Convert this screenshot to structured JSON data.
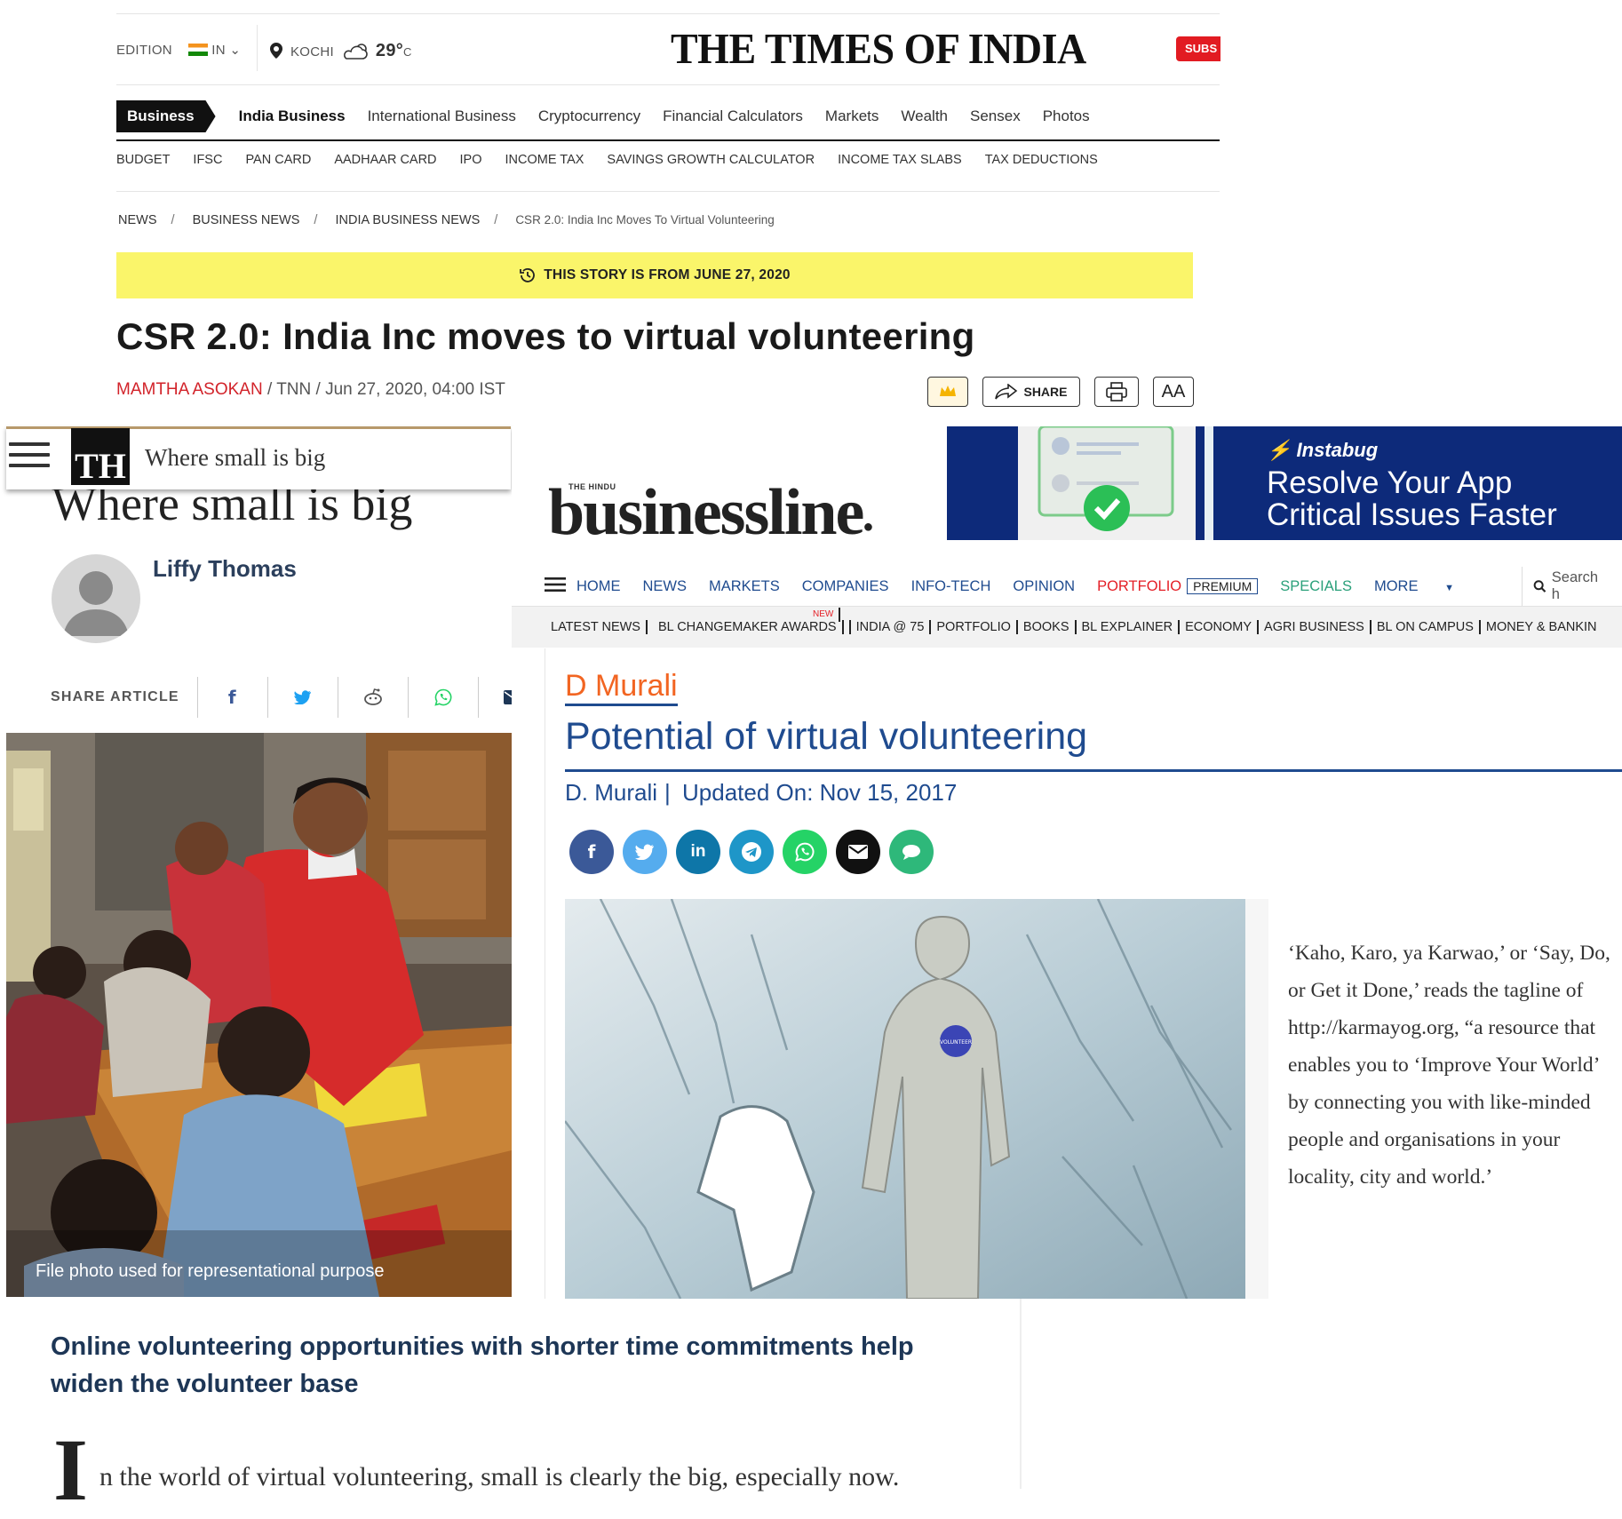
{
  "toi": {
    "edition_label": "EDITION",
    "edition_value": "IN",
    "city": "KOCHI",
    "temp": "29°",
    "temp_unit": "C",
    "logo": "THE TIMES OF INDIA",
    "subscribe": "SUBS",
    "nav_active": "Business",
    "nav": [
      "India Business",
      "International Business",
      "Cryptocurrency",
      "Financial Calculators",
      "Markets",
      "Wealth",
      "Sensex",
      "Photos"
    ],
    "subnav": [
      "BUDGET",
      "IFSC",
      "PAN CARD",
      "AADHAAR CARD",
      "IPO",
      "INCOME TAX",
      "SAVINGS GROWTH CALCULATOR",
      "INCOME TAX SLABS",
      "TAX DEDUCTIONS"
    ],
    "breadcrumb": [
      "NEWS",
      "BUSINESS NEWS",
      "INDIA BUSINESS NEWS",
      "CSR 2.0: India Inc Moves To Virtual Volunteering"
    ],
    "story_notice": "THIS STORY IS FROM JUNE 27, 2020",
    "headline": "CSR 2.0: India Inc moves to virtual volunteering",
    "author": "MAMTHA ASOKAN",
    "byline_rest": " / TNN / Jun 27, 2020, 04:00 IST",
    "share_label": "SHARE",
    "font_label": "AA"
  },
  "hindu": {
    "logo": "TH",
    "tagline": "Where small is big",
    "title": "Where small is big",
    "author": "Liffy Thomas",
    "share_label": "SHARE ARTICLE",
    "caption": "File photo used for representational purpose",
    "subheading": "Online volunteering opportunities with shorter time commitments help widen the volunteer base",
    "dropcap": "I",
    "body_start": "n the world of virtual volunteering, small is clearly the big, especially now."
  },
  "bl": {
    "logo_small": "THE HINDU",
    "logo_main": "businessline",
    "ad_brand": "Instabug",
    "ad_line1": "Resolve Your App",
    "ad_line2": "Critical Issues Faster",
    "nav": [
      "HOME",
      "NEWS",
      "MARKETS",
      "COMPANIES",
      "INFO-TECH",
      "OPINION"
    ],
    "nav_portfolio": "PORTFOLIO",
    "nav_premium": "PREMIUM",
    "nav_specials": "SPECIALS",
    "nav_more": "MORE",
    "search_placeholder": "Search h",
    "subnav": [
      "LATEST NEWS",
      "BL CHANGEMAKER AWARDS",
      "INDIA @ 75",
      "PORTFOLIO",
      "BOOKS",
      "BL EXPLAINER",
      "ECONOMY",
      "AGRI BUSINESS",
      "BL ON CAMPUS",
      "MONEY & BANKIN"
    ],
    "new_badge": "NEW",
    "column_author": "D Murali",
    "title": "Potential of virtual volunteering",
    "byline_author": "D. Murali",
    "byline_updated": "Updated On: Nov 15, 2017",
    "badge_text": "VOLUNTEER",
    "quote": "‘Kaho, Karo, ya Karwao,’ or ‘Say, Do, or Get it Done,’ reads the tagline of http://karmayog.org, “a resource that enables you to ‘Improve Your World’ by connecting you with like-minded people and organisations in your locality, city and world.’"
  },
  "colors": {
    "toi_red": "#d2232a",
    "hindu_navy": "#1d3656",
    "bl_blue": "#1f4b8f",
    "bl_orange": "#f26522",
    "yellow": "#faf56a"
  }
}
